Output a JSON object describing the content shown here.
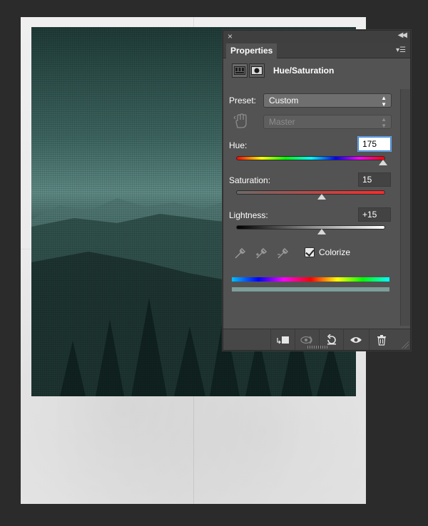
{
  "panel": {
    "tab_label": "Properties",
    "adjustment_title": "Hue/Saturation",
    "preset": {
      "label": "Preset:",
      "value": "Custom"
    },
    "channel": {
      "value": "Master"
    },
    "hue": {
      "label": "Hue:",
      "value": "175",
      "range": [
        -180,
        180
      ]
    },
    "saturation": {
      "label": "Saturation:",
      "value": "15",
      "range": [
        -100,
        100
      ]
    },
    "lightness": {
      "label": "Lightness:",
      "value": "+15",
      "range": [
        -100,
        100
      ]
    },
    "colorize": {
      "label": "Colorize",
      "checked": true
    },
    "colors": {
      "panel_bg": "#535353",
      "result_bar": "#7d9e99"
    }
  },
  "icons": {
    "close": "close-icon",
    "collapse": "collapse-icon",
    "panel_menu": "panel-menu-icon",
    "adjustment": "hue-saturation-icon",
    "mask": "mask-icon",
    "targeted_adjust": "hand-icon",
    "eyedroppers": [
      "eyedropper-icon",
      "eyedropper-plus-icon",
      "eyedropper-minus-icon"
    ],
    "bottom": [
      "clip-to-layer-icon",
      "view-previous-icon",
      "reset-icon",
      "visibility-eye-icon",
      "trash-icon"
    ]
  }
}
